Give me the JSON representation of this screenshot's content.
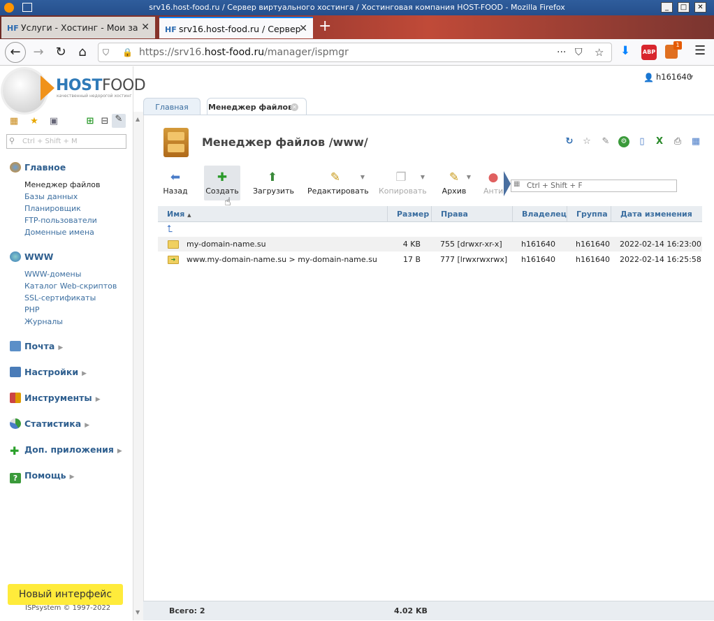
{
  "window": {
    "title": "srv16.host-food.ru / Сервер виртуального хостинга / Хостинговая компания HOST-FOOD - Mozilla Firefox"
  },
  "browser": {
    "tabs": [
      {
        "label": "Услуги - Хостинг - Мои за",
        "favicon": "HF"
      },
      {
        "label": "srv16.host-food.ru / Сервер",
        "favicon": "HF"
      }
    ],
    "new_tab": "+",
    "url_scheme": "https://srv16.",
    "url_host": "host-food.ru",
    "url_path": "/manager/ispmgr",
    "adblock_label": "ABP",
    "ext_badge": "1"
  },
  "logo": {
    "part1": "HOST",
    "part2": "FOOD",
    "tagline": "качественный недорогой хостинг"
  },
  "user": {
    "name": "h161640"
  },
  "sidebar": {
    "search_placeholder": "Ctrl + Shift + M",
    "sections": [
      {
        "title": "Главное",
        "items": [
          "Менеджер файлов",
          "Базы данных",
          "Планировщик",
          "FTP-пользователи",
          "Доменные имена"
        ]
      },
      {
        "title": "WWW",
        "items": [
          "WWW-домены",
          "Каталог Web-скриптов",
          "SSL-сертификаты",
          "PHP",
          "Журналы"
        ]
      },
      {
        "title": "Почта"
      },
      {
        "title": "Настройки"
      },
      {
        "title": "Инструменты"
      },
      {
        "title": "Статистика"
      },
      {
        "title": "Доп. приложения"
      },
      {
        "title": "Помощь"
      }
    ],
    "new_interface": "Новый интерфейс",
    "copyright": "ISPsystem © 1997-2022"
  },
  "page_tabs": [
    "Главная",
    "Менеджер файлов"
  ],
  "header": {
    "title": "Менеджер файлов /www/"
  },
  "toolbar": {
    "back": "Назад",
    "create": "Создать",
    "upload": "Загрузить",
    "edit": "Редактировать",
    "copy": "Копировать",
    "archive": "Архив",
    "anti": "Анти",
    "search_placeholder": "Ctrl + Shift + F"
  },
  "table": {
    "columns": [
      "Имя",
      "Размер",
      "Права",
      "Владелец",
      "Группа",
      "Дата изменения"
    ],
    "sort_indicator": "▲",
    "rows": [
      {
        "name": "my-domain-name.su",
        "size": "4 KB",
        "perm": "755 [drwxr-xr-x]",
        "owner": "h161640",
        "group": "h161640",
        "date": "2022-02-14 16:23:00"
      },
      {
        "name": "www.my-domain-name.su > my-domain-name.su",
        "size": "17 B",
        "perm": "777 [lrwxrwxrwx]",
        "owner": "h161640",
        "group": "h161640",
        "date": "2022-02-14 16:25:58"
      }
    ]
  },
  "footer": {
    "total": "Всего: 2",
    "size": "4.02 KB"
  }
}
